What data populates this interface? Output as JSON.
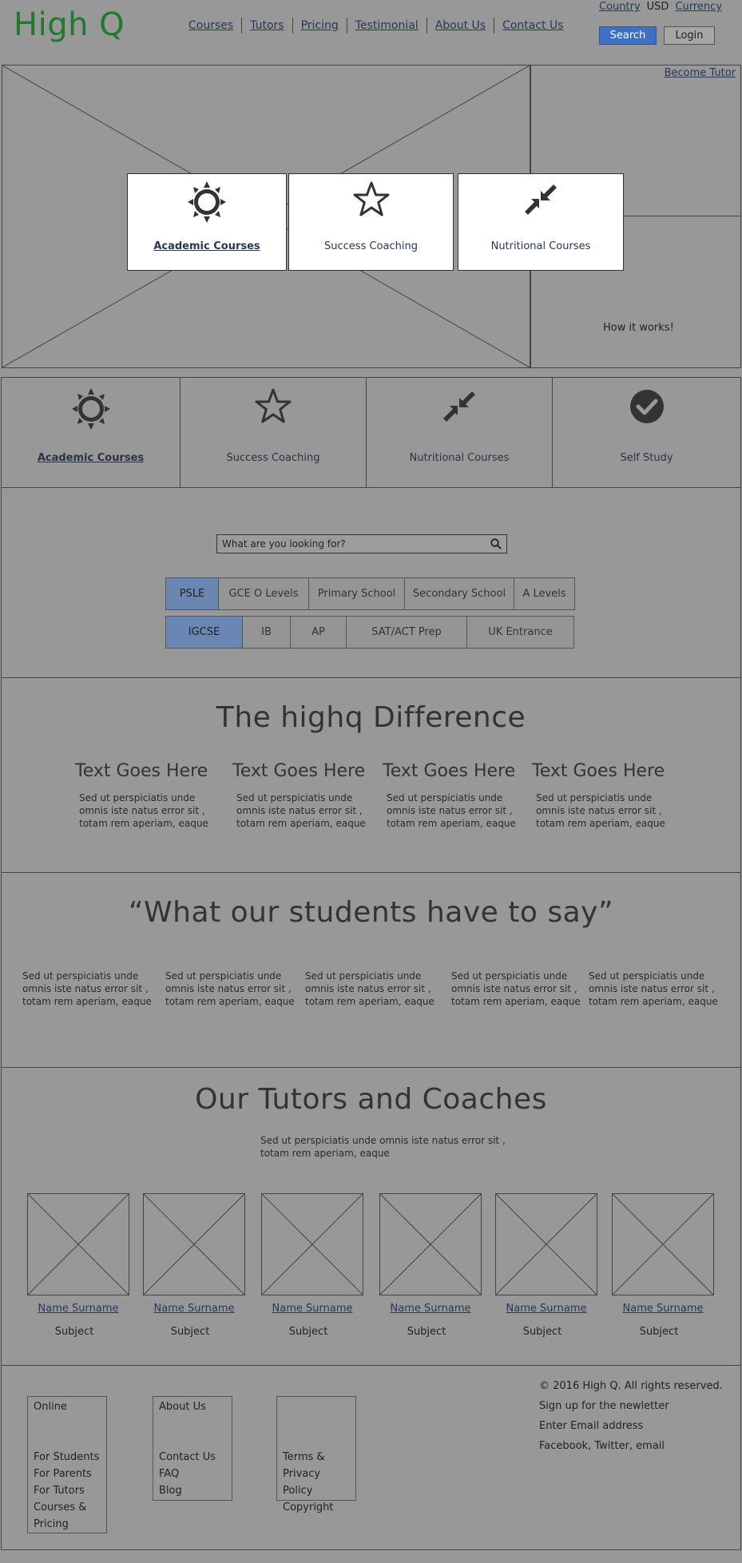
{
  "header": {
    "logo": "High Q",
    "nav": [
      "Courses",
      "Tutors",
      "Pricing",
      "Testimonial",
      "About Us",
      "Contact Us"
    ],
    "country_label": "Country",
    "currency_value": "USD",
    "currency_label": "Currency",
    "search_button": "Search",
    "login_button": "Login"
  },
  "hero": {
    "become_tutor": "Become Tutor",
    "cards": [
      "Academic Courses",
      "Success Coaching",
      "Nutritional Courses"
    ],
    "how_it_works": "How it works!"
  },
  "categories": {
    "items": [
      "Academic Courses",
      "Success Coaching",
      "Nutritional Courses",
      "Self Study"
    ]
  },
  "search": {
    "placeholder": "What are you looking for?",
    "row1": [
      "PSLE",
      "GCE O Levels",
      "Primary School",
      "Secondary School",
      "A Levels"
    ],
    "row2": [
      "IGCSE",
      "IB",
      "AP",
      "SAT/ACT Prep",
      "UK Entrance"
    ],
    "active": [
      "PSLE",
      "IGCSE"
    ]
  },
  "difference": {
    "title": "The highq Difference",
    "columns": [
      {
        "heading": "Text Goes Here",
        "text": "Sed ut perspiciatis unde omnis iste natus error sit , totam rem aperiam, eaque"
      },
      {
        "heading": "Text Goes Here",
        "text": "Sed ut perspiciatis unde omnis iste natus error sit , totam rem aperiam, eaque"
      },
      {
        "heading": "Text Goes Here",
        "text": "Sed ut perspiciatis unde omnis iste natus error sit , totam rem aperiam, eaque"
      },
      {
        "heading": "Text Goes Here",
        "text": "Sed ut perspiciatis unde omnis iste natus error sit , totam rem aperiam, eaque"
      }
    ]
  },
  "testimonials": {
    "title": "“What our students have to say”",
    "items": [
      "Sed ut perspiciatis unde omnis iste natus error sit , totam rem aperiam, eaque",
      "Sed ut perspiciatis unde omnis iste natus error sit , totam rem aperiam, eaque",
      "Sed ut perspiciatis unde omnis iste natus error sit , totam rem aperiam, eaque",
      "Sed ut perspiciatis unde omnis iste natus error sit , totam rem aperiam, eaque",
      "Sed ut perspiciatis unde omnis iste natus error sit , totam rem aperiam, eaque"
    ]
  },
  "tutors": {
    "title": "Our Tutors and Coaches",
    "intro": "Sed ut perspiciatis unde omnis iste natus error sit , totam rem aperiam, eaque",
    "people": [
      {
        "name": "Name Surname",
        "subject": "Subject"
      },
      {
        "name": "Name Surname",
        "subject": "Subject"
      },
      {
        "name": "Name Surname",
        "subject": "Subject"
      },
      {
        "name": "Name Surname",
        "subject": "Subject"
      },
      {
        "name": "Name Surname",
        "subject": "Subject"
      },
      {
        "name": "Name Surname",
        "subject": "Subject"
      }
    ]
  },
  "footer": {
    "col1": {
      "title": "Online",
      "links": [
        "For Students",
        "For Parents",
        "For Tutors",
        "Courses &",
        "Pricing"
      ]
    },
    "col2": {
      "title": "About Us",
      "links": [
        "Contact Us",
        "FAQ",
        "Blog"
      ]
    },
    "col3": {
      "title": "",
      "links": [
        "Terms &",
        "Privacy Policy",
        "Copyright"
      ]
    },
    "copyright": "© 2016 High Q. All rights reserved.",
    "newsletter": "Sign up for the newletter",
    "email": "Enter Email address",
    "social": "Facebook, Twitter, email"
  },
  "colors": {
    "background": "#989898",
    "logo": "#1f7a2e",
    "primary_button": "#3d6fc4",
    "active_pill": "#6a86b3",
    "link": "#27385a"
  }
}
